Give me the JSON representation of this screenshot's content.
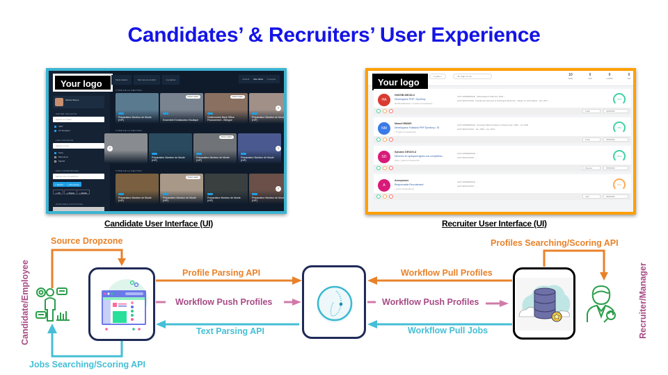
{
  "title": "Candidates’ & Recruiters’ User Experience",
  "candidate_ui": {
    "logo": "Your logo",
    "caption": "Candidate User Interface (UI)",
    "profile_name": "Martha Wayne",
    "tabs": [
      "Mode Netent",
      "Ma zone de confort",
      "A explorer"
    ],
    "nav": [
      "Accueil",
      "Mes offres",
      "A propos"
    ],
    "sidebar": {
      "section1": "METIER SOUHAITE",
      "input1": "Ajouter un métier",
      "options1": [
        {
          "label": "CEO",
          "checked": true
        },
        {
          "label": "UX Designer",
          "checked": true
        }
      ],
      "section2": "LIEU SOUHAITE",
      "input2": "Ajouter un lieu",
      "options2": [
        {
          "label": "Paris",
          "checked": true
        },
        {
          "label": "Barcelona",
          "checked": false
        },
        {
          "label": "Madrid",
          "checked": false
        }
      ],
      "section3": "MES COMPETENCES",
      "input3": "Ajouter une compétence",
      "tags_selected": [
        "+ Sketch",
        "+ Photoshop"
      ],
      "tags_other": [
        "+ UX",
        "+ Figma",
        "+ Adobe"
      ],
      "section4": "DOMAINES D'ACTIVITES"
    },
    "sections": [
      {
        "title": "TITRE DE LA SECTION",
        "cards": [
          {
            "title": "Préparateur Monteur de Moule (H/F)",
            "badge": "CDI",
            "match": "",
            "color": "#5a7a90"
          },
          {
            "title": "Ensemble Echafaudeur Boutique",
            "badge": "CDI",
            "match": "Perfect match",
            "color": "#7a8490"
          },
          {
            "title": "Gestionnaire Back Office Financement - Bilingue",
            "badge": "CDI",
            "match": "Perfect match",
            "color": "#8a7060"
          },
          {
            "title": "Préparateur Monteur de Moule (H/F)",
            "badge": "CDI",
            "match": "",
            "color": "#a09088"
          }
        ]
      },
      {
        "title": "TITRE DE LA SECTION",
        "cards": [
          {
            "title": "",
            "badge": "",
            "match": "",
            "color": "#888c90"
          },
          {
            "title": "Préparateur Monteur de Moule (H/F)",
            "badge": "CDI",
            "match": "",
            "color": "#2a4a60"
          },
          {
            "title": "Préparateur Monteur de Moule (H/F)",
            "badge": "CDI",
            "match": "Perfect match",
            "color": "#707478"
          },
          {
            "title": "Préparateur Monteur de Moule (H/F)",
            "badge": "CDI",
            "match": "",
            "color": "#4a5a90"
          }
        ]
      },
      {
        "title": "TITRE DE LA SECTION",
        "cards": [
          {
            "title": "Préparateur Monteur de Moule (H/F)",
            "badge": "CDI",
            "match": "",
            "color": "#7a6040"
          },
          {
            "title": "Préparateur Monteur de Moule (H/F)",
            "badge": "CDI",
            "match": "Perfect match",
            "color": "#a89888"
          },
          {
            "title": "Préparateur Monteur de Moule (H/F)",
            "badge": "CDI",
            "match": "",
            "color": "#3a4040"
          },
          {
            "title": "Préparateur Monteur de Moule (H/F)",
            "badge": "CDI",
            "match": "",
            "color": "#6a5048"
          }
        ]
      }
    ]
  },
  "recruiter_ui": {
    "logo": "Your logo",
    "caption": "Recruiter User Interface (UI)",
    "filters": [
      "0 years +",
      "All: High to Low"
    ],
    "stats": [
      {
        "value": "10",
        "label": "NEW"
      },
      {
        "value": "0",
        "label": "YES"
      },
      {
        "value": "0",
        "label": "LATER"
      },
      {
        "value": "0",
        "label": "NO"
      }
    ],
    "candidates": [
      {
        "initials": "HA",
        "name": "HASSIB ABOULU",
        "job": "Développeur PHP / Symfony",
        "exp": "Neuilly-Plaisance  • 2 years of experience",
        "last_exp": "LAST EXPERIENCE · ODéveloppeur PHP  Nov. 2019 –",
        "last_edu": "LAST EDUCATION · Faculté des Sciences et Techniques Ecole des · Master en Informatique · Jan. 2017 –",
        "score": "78%",
        "color": "#d93a32",
        "score_color": "#3ed1a4",
        "button": "Traiter",
        "date": "30/06/2020"
      },
      {
        "initials": "NM",
        "name": "Nassef MWADI",
        "job": "Développeur Fullstack PHP Symfony / JS",
        "exp": "• 5 years of experience",
        "last_exp": "LAST EXPERIENCE · Developer Back Freelance et Delivery  Apr. 1900 – Jul. 1900",
        "last_edu": "LAST EDUCATION · Jan. 2008 – Jan. 2010",
        "score": "78%",
        "color": "#3a7ae8",
        "score_color": "#3ed1a4",
        "button": "Traiter",
        "date": "29/06/2020"
      },
      {
        "initials": "SD",
        "name": "Sylvaine DEVAYLU",
        "job": "Décrivez en quelques lignes vos compétenc...",
        "exp": "Paris  • years of experience",
        "last_exp": "LAST EXPERIENCE · –",
        "last_edu": "LAST EDUCATION · –",
        "score": "65%",
        "color": "#d81b7a",
        "score_color": "#3ed1a4",
        "button": "Moyenne",
        "date": "05/06/2020"
      },
      {
        "initials": "A",
        "name": "Anonymous",
        "job": "Responsable Recrutement",
        "exp": "• years of experience",
        "last_exp": "LAST EXPERIENCE · –",
        "last_edu": "LAST EDUCATION · –",
        "score": "53%",
        "color": "#d81b7a",
        "score_color": "#ffaa55",
        "button": "Lator",
        "date": "05/06/2020"
      }
    ]
  },
  "diagram": {
    "actors": {
      "candidate": "Candidate/Employee",
      "recruiter": "Recruiter/Manager"
    },
    "labels": {
      "source_dropzone": "Source Dropzone",
      "jobs_search": "Jobs Searching/Scoring API",
      "profile_parsing": "Profile Parsing API",
      "push_left": "Workflow Push Profiles",
      "text_parsing": "Text Parsing API",
      "pull_profiles": "Workflow Pull Profiles",
      "push_right": "Workflow Push Profiles",
      "pull_jobs": "Workflow Pull Jobs",
      "profiles_search": "Profiles Searching/Scoring  API"
    },
    "nodes": {
      "app": "web-app-icon",
      "engine": "engine-logo-icon",
      "database": "cloud-database-icon"
    },
    "colors": {
      "orange": "#e8822a",
      "purple": "#a84b86",
      "cyan": "#45bfd6",
      "green": "#2a9d4a",
      "navy": "#1f2a57",
      "title": "#1414e6"
    }
  }
}
